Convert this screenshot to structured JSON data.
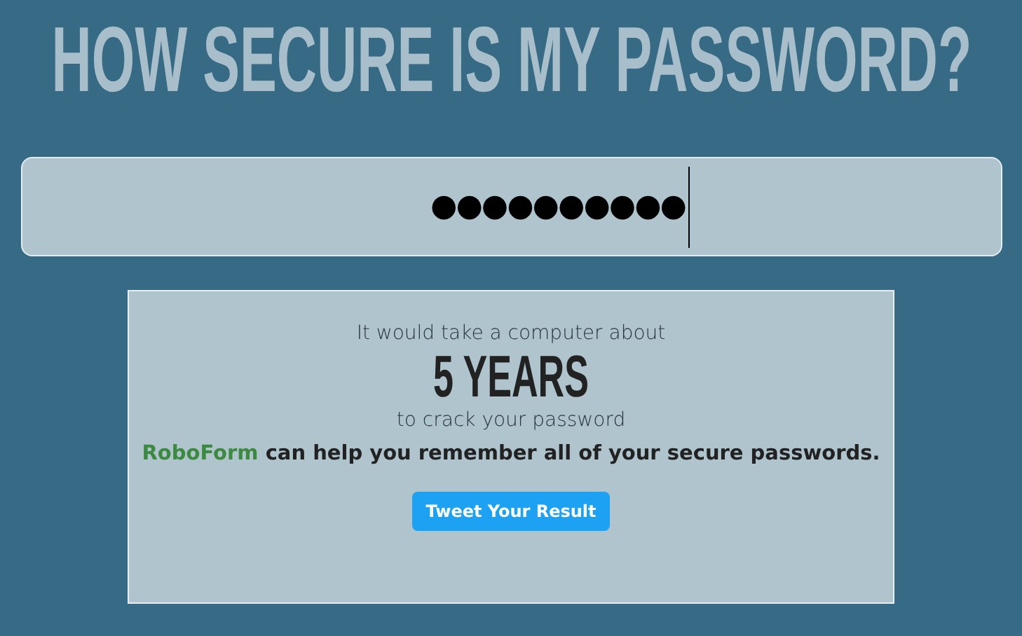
{
  "title": "HOW SECURE IS MY PASSWORD?",
  "password_field": {
    "value": "●●●●●●●●●●"
  },
  "result": {
    "intro": "It would take a computer about",
    "time": "5 YEARS",
    "outro": "to crack your password",
    "promo_link": "RoboForm",
    "promo_text": "can help you remember all of your secure passwords.",
    "button": "Tweet Your Result"
  }
}
